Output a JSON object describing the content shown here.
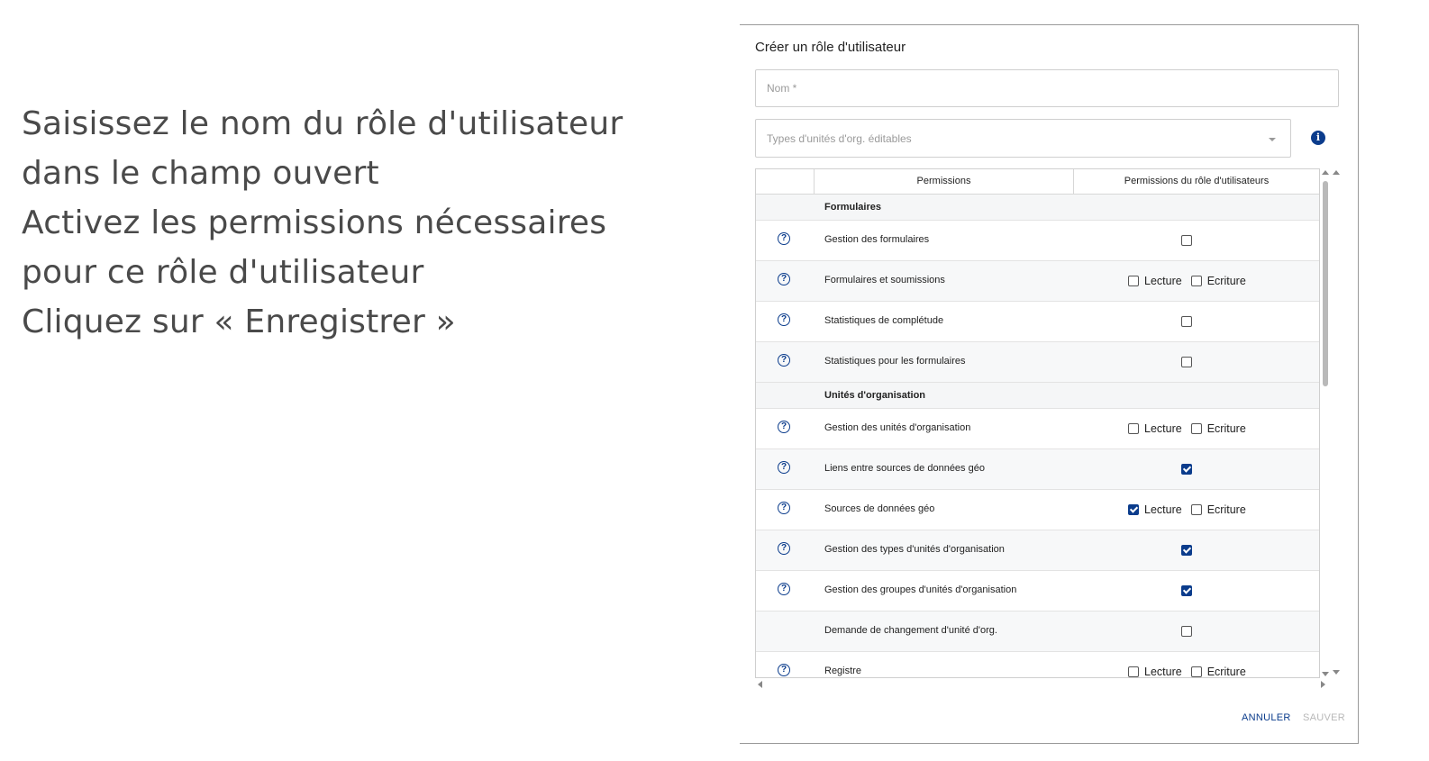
{
  "instructions": {
    "line1": "Saisissez le nom du rôle d'utilisateur dans le champ ouvert",
    "line2": "Activez les permissions nécessaires pour ce rôle d'utilisateur",
    "line3": "Cliquez sur « Enregistrer »"
  },
  "dialog": {
    "title": "Créer un rôle d'utilisateur",
    "name_placeholder": "Nom *",
    "types_placeholder": "Types d'unités d'org. éditables",
    "info_icon": "info-icon",
    "cancel_label": "ANNULER",
    "save_label": "SAUVER"
  },
  "table": {
    "headers": {
      "permissions": "Permissions",
      "role_permissions": "Permissions du rôle d'utilisateurs"
    },
    "read_label": "Lecture",
    "write_label": "Ecriture",
    "sections": [
      {
        "name": "Formulaires",
        "rows": [
          {
            "label": "Gestion des formulaires",
            "help": true,
            "type": "single",
            "checked": false
          },
          {
            "label": "Formulaires et soumissions",
            "help": true,
            "type": "rw",
            "read": false,
            "write": false
          },
          {
            "label": "Statistiques de complétude",
            "help": true,
            "type": "single",
            "checked": false
          },
          {
            "label": "Statistiques pour les formulaires",
            "help": true,
            "type": "single",
            "checked": false
          }
        ]
      },
      {
        "name": "Unités d'organisation",
        "rows": [
          {
            "label": "Gestion des unités d'organisation",
            "help": true,
            "type": "rw",
            "read": false,
            "write": false
          },
          {
            "label": "Liens entre sources de données géo",
            "help": true,
            "type": "single",
            "checked": true
          },
          {
            "label": "Sources de données géo",
            "help": true,
            "type": "rw",
            "read": true,
            "write": false
          },
          {
            "label": "Gestion des types d'unités d'organisation",
            "help": true,
            "type": "single",
            "checked": true
          },
          {
            "label": "Gestion des groupes d'unités d'organisation",
            "help": true,
            "type": "single",
            "checked": true
          },
          {
            "label": "Demande de changement d'unité d'org.",
            "help": false,
            "type": "single",
            "checked": false
          },
          {
            "label": "Registre",
            "help": true,
            "type": "rw",
            "read": false,
            "write": false
          }
        ]
      }
    ]
  }
}
